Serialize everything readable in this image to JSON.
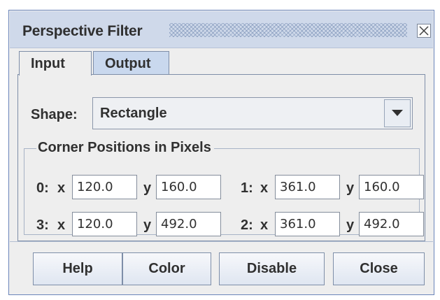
{
  "window": {
    "title": "Perspective Filter"
  },
  "tabs": [
    {
      "label": "Input"
    },
    {
      "label": "Output"
    }
  ],
  "shape": {
    "label": "Shape:",
    "value": "Rectangle"
  },
  "corners": {
    "legend": "Corner Positions in Pixels",
    "x_label": "x",
    "y_label": "y",
    "items": [
      {
        "label": "0:",
        "x": "120.0",
        "y": "160.0"
      },
      {
        "label": "1:",
        "x": "361.0",
        "y": "160.0"
      },
      {
        "label": "3:",
        "x": "120.0",
        "y": "492.0"
      },
      {
        "label": "2:",
        "x": "361.0",
        "y": "492.0"
      }
    ]
  },
  "buttons": {
    "help": "Help",
    "color": "Color",
    "disable": "Disable",
    "close": "Close"
  },
  "icons": {
    "close": "close-icon",
    "dropdown": "chevron-down-icon"
  },
  "colors": {
    "accent": "#cfd9ea",
    "border": "#6a85ba",
    "selected_tab": "#c9d8ee"
  }
}
